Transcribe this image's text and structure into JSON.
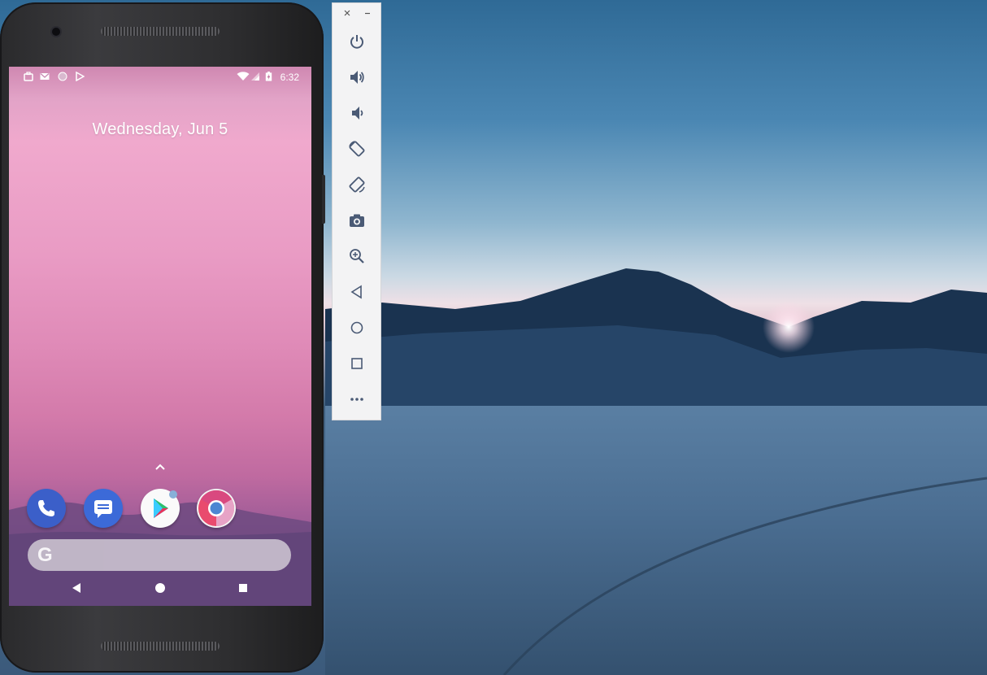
{
  "phone": {
    "status_bar": {
      "time": "6:32",
      "left_icons": [
        "briefcase-icon",
        "gmail-icon",
        "circle-icon",
        "play-store-icon"
      ],
      "right_icons": [
        "wifi-icon",
        "signal-icon",
        "battery-icon"
      ]
    },
    "home": {
      "date": "Wednesday, Jun 5",
      "dock_apps": [
        "phone-app",
        "messages-app",
        "play-store-app",
        "chrome-app"
      ],
      "search_logo": "G"
    },
    "nav": [
      "back",
      "home",
      "recents"
    ]
  },
  "toolbar": {
    "window_controls": [
      "close",
      "minimize"
    ],
    "buttons": [
      "power",
      "volume-up",
      "volume-down",
      "rotate-left",
      "rotate-right",
      "screenshot",
      "zoom",
      "back",
      "home",
      "overview",
      "more"
    ]
  },
  "colors": {
    "toolbar_icon": "#4a5a75",
    "screen_top": "#f0a9cd",
    "screen_bottom": "#6a4a80"
  }
}
